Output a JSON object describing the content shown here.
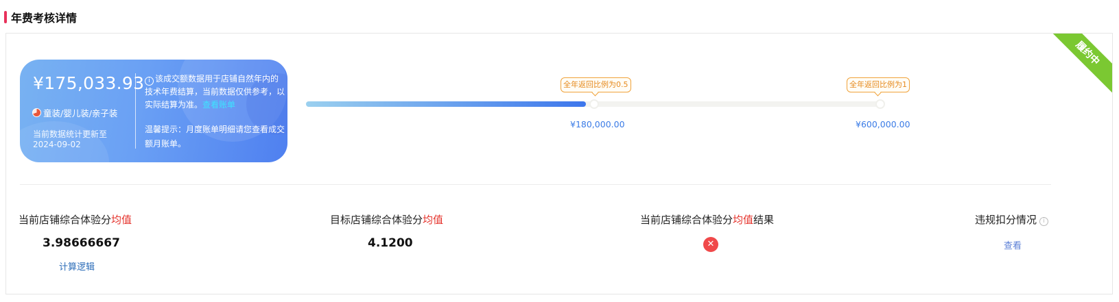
{
  "section": {
    "title": "年费考核详情"
  },
  "status_ribbon": "履约中",
  "summary_card": {
    "amount": "¥175,033.93",
    "category": "童装/婴儿装/亲子装",
    "update_label": "当前数据统计更新至",
    "update_date": "2024-09-02",
    "note_text": "该成交额数据用于店铺自然年内的技术年费结算，当前数据仅供参考，以实际结算为准。",
    "note_link": "查看账单",
    "tip_text": "温馨提示：月度账单明细请您查看成交额月账单。"
  },
  "progress": {
    "current_amount": 175033.93,
    "milestones": [
      {
        "label": "全年返回比例为0.5",
        "value_text": "¥180,000.00",
        "value": 180000
      },
      {
        "label": "全年返回比例为1",
        "value_text": "¥600,000.00",
        "value": 600000
      }
    ]
  },
  "metrics": [
    {
      "label_prefix": "当前店铺综合体验分",
      "label_highlight": "均值",
      "label_suffix": "",
      "value": "3.98666667",
      "link": "计算逻辑"
    },
    {
      "label_prefix": "目标店铺综合体验分",
      "label_highlight": "均值",
      "label_suffix": "",
      "value": "4.1200"
    },
    {
      "label_prefix": "当前店铺综合体验分",
      "label_highlight": "均值",
      "label_suffix": "结果",
      "result_icon": "close-icon",
      "result": "fail"
    },
    {
      "label": "违规扣分情况",
      "help_icon": "info-icon",
      "link": "查看"
    }
  ],
  "colors": {
    "accent": "#e8315b",
    "ribbon": "#7bc832",
    "highlight": "#e5322b",
    "link": "#2b6cb8",
    "fail": "#f0494a"
  }
}
